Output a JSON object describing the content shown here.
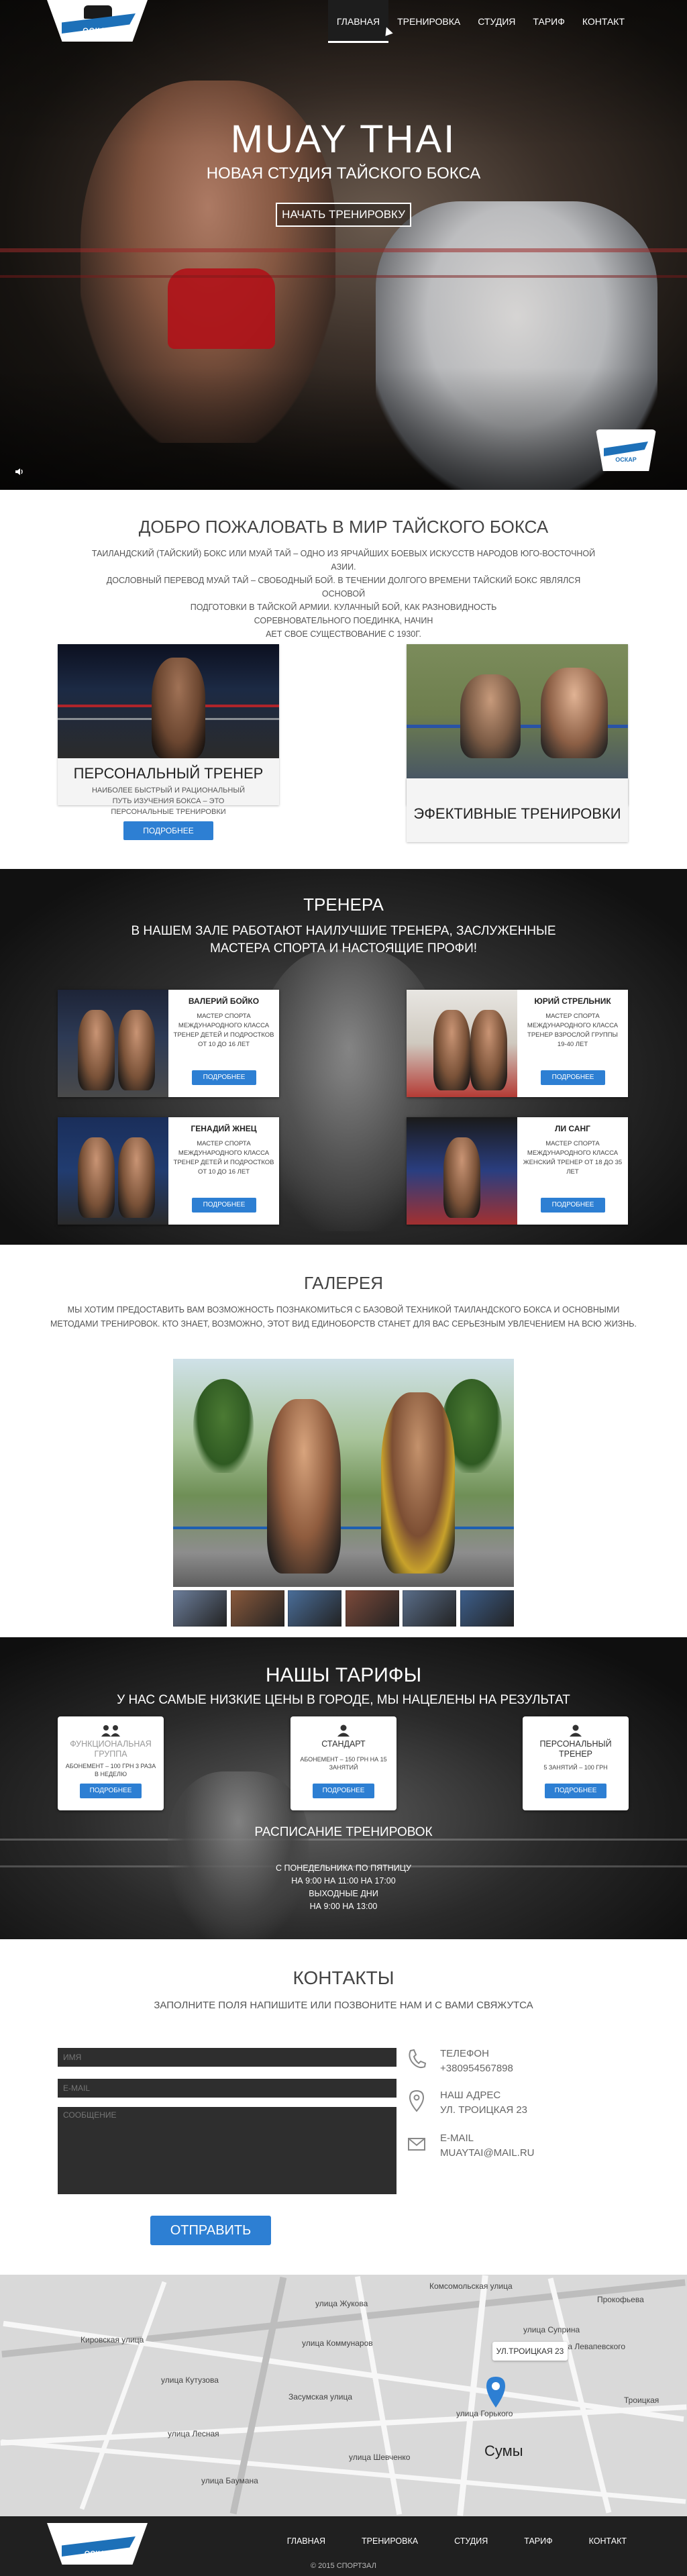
{
  "nav": {
    "items": [
      "Главная",
      "Тренировка",
      "Студия",
      "Тариф",
      "Контакт"
    ],
    "active": 0
  },
  "logo": {
    "text": "ОСКАР"
  },
  "hero": {
    "title": "MUAY THAI",
    "subtitle": "НОВАЯ СТУДИЯ ТАЙСКОГО БОКСА",
    "button": "НАЧАТЬ ТРЕНИРОВКУ"
  },
  "welcome": {
    "title": "ДОБРО ПОЖАЛОВАТЬ В МИР ТАЙСКОГО БОКСА",
    "text": [
      "ТАИЛАНДСКИЙ (ТАЙСКИЙ) БОКС ИЛИ МУАЙ ТАЙ – ОДНО ИЗ ЯРЧАЙШИХ БОЕВЫХ ИСКУССТВ НАРОДОВ ЮГО-ВОСТОЧНОЙ АЗИИ.",
      "ДОСЛОВНЫЙ ПЕРЕВОД МУАЙ ТАЙ – СВОБОДНЫЙ БОЙ. В ТЕЧЕНИИ ДОЛГОГО ВРЕМЕНИ ТАЙСКИЙ БОКС ЯВЛЯЛСЯ ОСНОВОЙ",
      "ПОДГОТОВКИ В ТАЙСКОЙ АРМИИ. КУЛАЧНЫЙ БОЙ, КАК РАЗНОВИДНОСТЬ",
      "СОРЕВНОВАТЕЛЬНОГО ПОЕДИНКА, НАЧИН",
      "АЕТ СВОЕ СУЩЕСТВОВАНИЕ С 1930Г."
    ],
    "cards": [
      {
        "title": "ПЕРСОНАЛЬНЫЙ ТРЕНЕР",
        "desc": "НАИБОЛЕЕ БЫСТРЫЙ И РАЦИОНАЛЬНЫЙ ПУТЬ ИЗУЧЕНИЯ БОКСА – ЭТО ПЕРСОНАЛЬНЫЕ ТРЕНИРОВКИ",
        "button": "ПОДРОБНЕЕ"
      },
      {
        "title": "ЭФЕКТИВНЫЕ ТРЕНИРОВКИ"
      }
    ]
  },
  "trainers": {
    "title": "ТРЕНЕРА",
    "subtitle": "В НАШЕМ ЗАЛЕ РАБОТАЮТ НАИЛУЧШИЕ ТРЕНЕРА, ЗАСЛУЖЕННЫЕ МАСТЕРА СПОРТА И НАСТОЯЩИЕ ПРОФИ!",
    "items": [
      {
        "name": "ВАЛЕРИЙ БОЙКО",
        "desc": "МАСТЕР СПОРТА МЕЖДУНАРОДНОГО КЛАССА ТРЕНЕР ДЕТЕЙ И ПОДРОСТКОВ ОТ 10 ДО 16 ЛЕТ",
        "button": "ПОДРОБНЕЕ"
      },
      {
        "name": "ЮРИЙ СТРЕЛЬНИК",
        "desc": "МАСТЕР СПОРТА МЕЖДУНАРОДНОГО КЛАССА ТРЕНЕР ВЗРОСЛОЙ ГРУППЫ 19-40 ЛЕТ",
        "button": "ПОДРОБНЕЕ"
      },
      {
        "name": "ГЕНАДИЙ ЖНЕЦ",
        "desc": "МАСТЕР СПОРТА МЕЖДУНАРОДНОГО КЛАССА ТРЕНЕР ДЕТЕЙ И ПОДРОСТКОВ ОТ 10 ДО 16 ЛЕТ",
        "button": "ПОДРОБНЕЕ"
      },
      {
        "name": "ЛИ САНГ",
        "desc": "МАСТЕР СПОРТА МЕЖДУНАРОДНОГО КЛАССА ЖЕНСКИЙ ТРЕНЕР ОТ 18 ДО 35 ЛЕТ",
        "button": "ПОДРОБНЕЕ"
      }
    ]
  },
  "gallery": {
    "title": "ГАЛЕРЕЯ",
    "text": "МЫ ХОТИМ ПРЕДОСТАВИТЬ ВАМ ВОЗМОЖНОСТЬ ПОЗНАКОМИТЬСЯ С БАЗОВОЙ ТЕХНИКОЙ ТАИЛАНДСКОГО БОКСА И ОСНОВНЫМИ МЕТОДАМИ ТРЕНИРОВОК. КТО ЗНАЕТ, ВОЗМОЖНО, ЭТОТ ВИД ЕДИНОБОРСТВ СТАНЕТ ДЛЯ ВАС СЕРЬЕЗНЫМ УВЛЕЧЕНИЕМ НА ВСЮ ЖИЗНЬ.",
    "thumb_colors": [
      "#6d7f9c",
      "#8b5a3c",
      "#4a6e9a",
      "#7d4a3a",
      "#5a6e8a",
      "#3d5f8c"
    ]
  },
  "tariffs": {
    "title": "НАШЫ ТАРИФЫ",
    "subtitle": "У НАС САМЫЕ НИЗКИЕ ЦЕНЫ В ГОРОДЕ, МЫ НАЦЕЛЕНЫ НА РЕЗУЛЬТАТ",
    "items": [
      {
        "name": "ФУНКЦИОНАЛЬНАЯ ГРУППА",
        "desc": "АБОНЕМЕНТ – 100 ГРН 3 РАЗА В НЕДЕЛЮ",
        "button": "ПОДРОБНЕЕ"
      },
      {
        "name": "СТАНДАРТ",
        "desc": "АБОНЕМЕНТ – 150 ГРН НА 15 ЗАНЯТИЙ",
        "button": "ПОДРОБНЕЕ"
      },
      {
        "name": "ПЕРСОНАЛЬНЫЙ ТРЕНЕР",
        "desc": "5 ЗАНЯТИЙ – 100 ГРН",
        "button": "ПОДРОБНЕЕ"
      }
    ],
    "schedule_title": "РАСПИСАНИЕ ТРЕНИРОВОК",
    "schedule": [
      "С ПОНЕДЕЛЬНИКА ПО ПЯТНИЦУ",
      "НА 9:00 НА 11:00 НА 17:00",
      "ВЫХОДНЫЕ ДНИ",
      "НА 9:00 НА 13:00"
    ]
  },
  "contacts": {
    "title": "КОНТАКТЫ",
    "subtitle": "ЗАПОЛНИТЕ ПОЛЯ НАПИШИТЕ ИЛИ ПОЗВОНИТЕ НАМ И С ВАМИ СВЯЖУТСА",
    "form": {
      "name_placeholder": "ИМЯ",
      "email_placeholder": "E-MAIL",
      "message_placeholder": "СООБЩЕНИЕ",
      "submit": "ОТПРАВИТЬ"
    },
    "info": [
      {
        "icon": "phone-icon",
        "label": "ТЕЛЕФОН",
        "value": "+380954567898"
      },
      {
        "icon": "location-icon",
        "label": "НАШ АДРЕС",
        "value": "УЛ. ТРОИЦКАЯ 23"
      },
      {
        "icon": "mail-icon",
        "label": "E-MAIL",
        "value": "MUAYTAI@MAIL.RU"
      }
    ]
  },
  "map": {
    "callout": "УЛ.ТРОИЦКАЯ 23",
    "city": "Сумы",
    "labels": [
      "улица Жукова",
      "Комсомольская улица",
      "улица Кутузова",
      "улица Коммунаров",
      "Засумская улица",
      "улица Лесная",
      "улица Баумана",
      "улица Шевченко",
      "улица Суприна",
      "улица Левапевского",
      "улица Горького",
      "Кировская улица",
      "Прокофьева",
      "Троицкая"
    ]
  },
  "footer": {
    "nav": [
      "ГЛАВНАЯ",
      "ТРЕНИРОВКА",
      "СТУДИЯ",
      "ТАРИФ",
      "КОНТАКТ"
    ],
    "copyright": "© 2015 СПОРТЗАЛ"
  },
  "colors": {
    "accent": "#2d7fd3",
    "dark": "#202020",
    "field": "#2e2e2e"
  }
}
